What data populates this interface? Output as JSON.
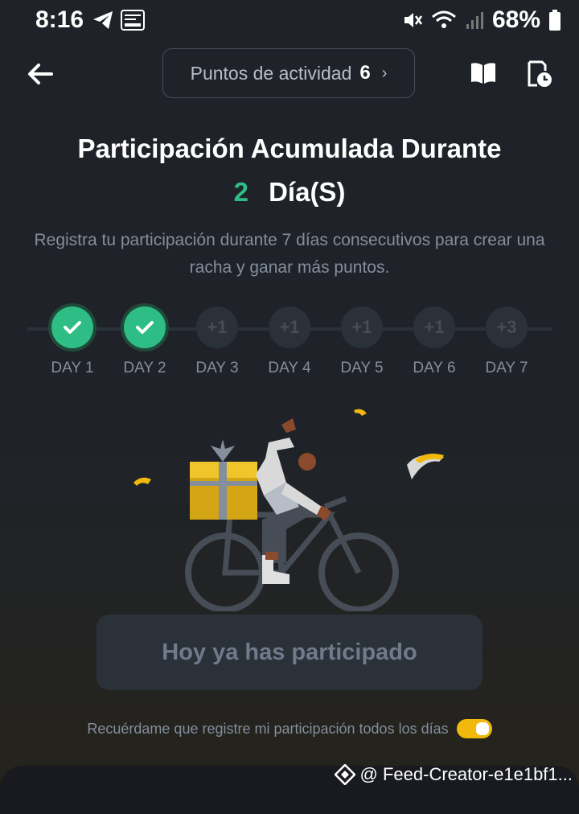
{
  "status_bar": {
    "time": "8:16",
    "battery": "68%"
  },
  "header": {
    "points_label": "Puntos de actividad",
    "points_value": "6"
  },
  "streak": {
    "title_line1": "Participación Acumulada Durante",
    "days_count": "2",
    "days_unit": "Día(S)",
    "description": "Registra tu participación durante 7 días consecutivos para crear una racha y ganar más puntos.",
    "steps": [
      {
        "label": "DAY 1",
        "bonus": "",
        "done": true
      },
      {
        "label": "DAY 2",
        "bonus": "",
        "done": true
      },
      {
        "label": "DAY 3",
        "bonus": "+1",
        "done": false
      },
      {
        "label": "DAY 4",
        "bonus": "+1",
        "done": false
      },
      {
        "label": "DAY 5",
        "bonus": "+1",
        "done": false
      },
      {
        "label": "DAY 6",
        "bonus": "+1",
        "done": false
      },
      {
        "label": "DAY 7",
        "bonus": "+3",
        "done": false
      }
    ]
  },
  "action": {
    "button_label": "Hoy ya has participado"
  },
  "reminder": {
    "label": "Recuérdame que registre mi participación todos los días",
    "enabled": true
  },
  "watermark": {
    "text": "@ Feed-Creator-e1e1bf1..."
  },
  "colors": {
    "accent_green": "#2ebd85",
    "accent_yellow": "#f0b90b",
    "background": "#1f2329"
  }
}
